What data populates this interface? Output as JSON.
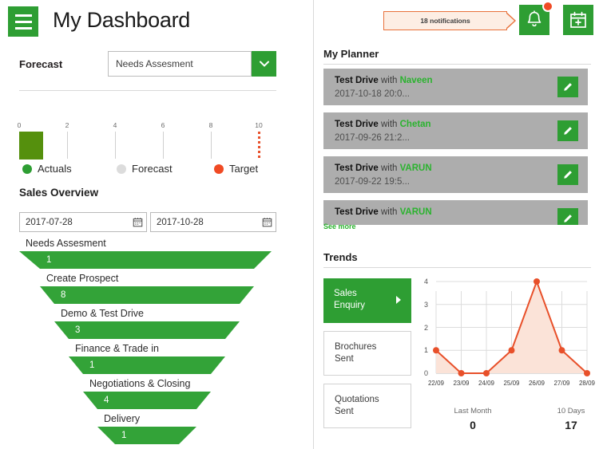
{
  "header": {
    "title": "My Dashboard",
    "menu_icon": "hamburger-menu-icon",
    "notifications_text": "18 notifications",
    "bell_icon": "bell-icon",
    "calendar_icon": "calendar-add-icon"
  },
  "forecast": {
    "label": "Forecast",
    "selected": "Needs Assesment",
    "chevron_icon": "chevron-down-icon"
  },
  "bullet_chart": {
    "ticks": [
      "0",
      "2",
      "4",
      "6",
      "8",
      "10"
    ],
    "actual_value": 1,
    "target_value": 10,
    "axis_max": 10,
    "legend": [
      {
        "label": "Actuals",
        "color": "#2e9e33"
      },
      {
        "label": "Forecast",
        "color": "#dcdcdc"
      },
      {
        "label": "Target",
        "color": "#f04a24"
      }
    ]
  },
  "sales_overview": {
    "title": "Sales Overview",
    "date_from": "2017-07-28",
    "date_to": "2017-10-28",
    "calendar_icon": "calendar-icon",
    "funnel": [
      {
        "label": "Needs Assesment",
        "value": "1"
      },
      {
        "label": "Create Prospect",
        "value": "8"
      },
      {
        "label": "Demo & Test Drive",
        "value": "3"
      },
      {
        "label": "Finance & Trade in",
        "value": "1"
      },
      {
        "label": "Negotiations & Closing",
        "value": "4"
      },
      {
        "label": "Delivery",
        "value": "1"
      }
    ]
  },
  "planner": {
    "title": "My Planner",
    "see_more": "See more",
    "edit_icon": "pencil-edit-icon",
    "items": [
      {
        "activity": "Test Drive",
        "with": "with",
        "person": "Naveen",
        "datetime": "2017-10-18 20:0..."
      },
      {
        "activity": "Test Drive",
        "with": "with",
        "person": "Chetan",
        "datetime": "2017-09-26 21:2..."
      },
      {
        "activity": "Test Drive",
        "with": "with",
        "person": "VARUN",
        "datetime": "2017-09-22 19:5..."
      },
      {
        "activity": "Test Drive",
        "with": "with",
        "person": "VARUN",
        "datetime": ""
      }
    ]
  },
  "trends": {
    "title": "Trends",
    "categories": [
      {
        "label_line1": "Sales",
        "label_line2": "Enquiry",
        "active": true
      },
      {
        "label_line1": "Brochures",
        "label_line2": "Sent",
        "active": false
      },
      {
        "label_line1": "Quotations",
        "label_line2": "Sent",
        "active": false
      }
    ],
    "footer": [
      {
        "label": "Last Month",
        "value": "0"
      },
      {
        "label": "10 Days",
        "value": "17"
      }
    ]
  },
  "chart_data": {
    "type": "line",
    "title": "Trends",
    "series_name": "Sales Enquiry",
    "categories": [
      "22/09",
      "23/09",
      "24/09",
      "25/09",
      "26/09",
      "27/09",
      "28/09"
    ],
    "values": [
      1,
      0,
      0,
      1,
      4,
      1,
      0
    ],
    "yticks": [
      0,
      1,
      2,
      3,
      4
    ],
    "ylim": [
      0,
      4
    ],
    "xlabel": "",
    "ylabel": "",
    "grid": true,
    "line_color": "#e8502a",
    "fill_color": "#fbe3d8",
    "legend": "none"
  }
}
